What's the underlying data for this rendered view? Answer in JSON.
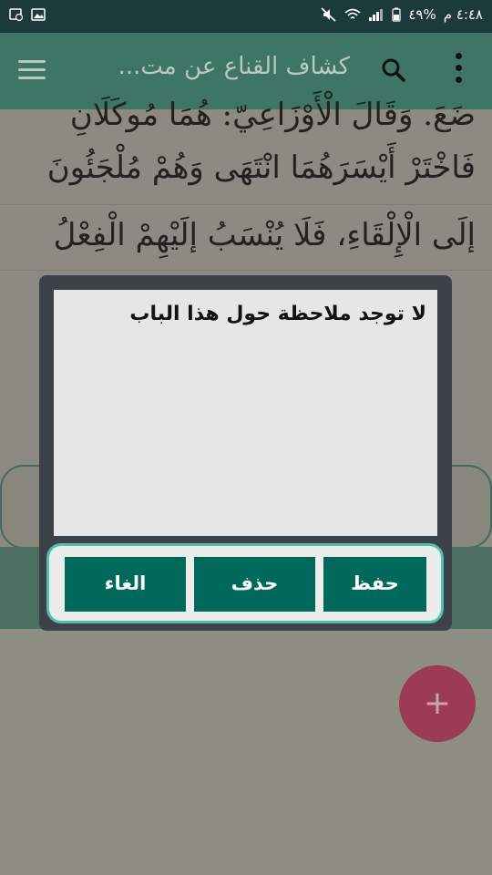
{
  "status_bar": {
    "time": "٤:٤٨ م",
    "battery": "%٤٩",
    "icons": [
      "mute-icon",
      "wifi-icon",
      "signal-icon",
      "battery-icon",
      "image-icon",
      "screenshot-icon"
    ]
  },
  "app_bar": {
    "title": "كشاف القناع عن مت...",
    "icons": [
      "menu-icon",
      "search-icon",
      "more-vert-icon"
    ]
  },
  "content": {
    "lines": [
      "ضَعَ. وَقَالَ الْأَوْزَاعِيّ: هُمَا مُوكَلَانِ",
      "فَاخْتَرْ أَيْسَرَهُمَا انْتَهَى وَهُمْ مُلْجَئُونَ",
      "إلَى الْإِلْقَاءِ، فَلَا يُنْسَبُ إلَيْهِمْ الْفِعْلُ"
    ]
  },
  "dialog": {
    "note_text": "لا توجد ملاحظة حول هذا الباب",
    "save_label": "حفظ",
    "delete_label": "حذف",
    "cancel_label": "الغاء"
  },
  "fab": {
    "label": "+"
  },
  "colors": {
    "status_bar": "#1d3a3a",
    "app_bar": "#3f7564",
    "button": "#00695c",
    "button_frame": "#52c0b0",
    "fab": "#9c3b55"
  }
}
